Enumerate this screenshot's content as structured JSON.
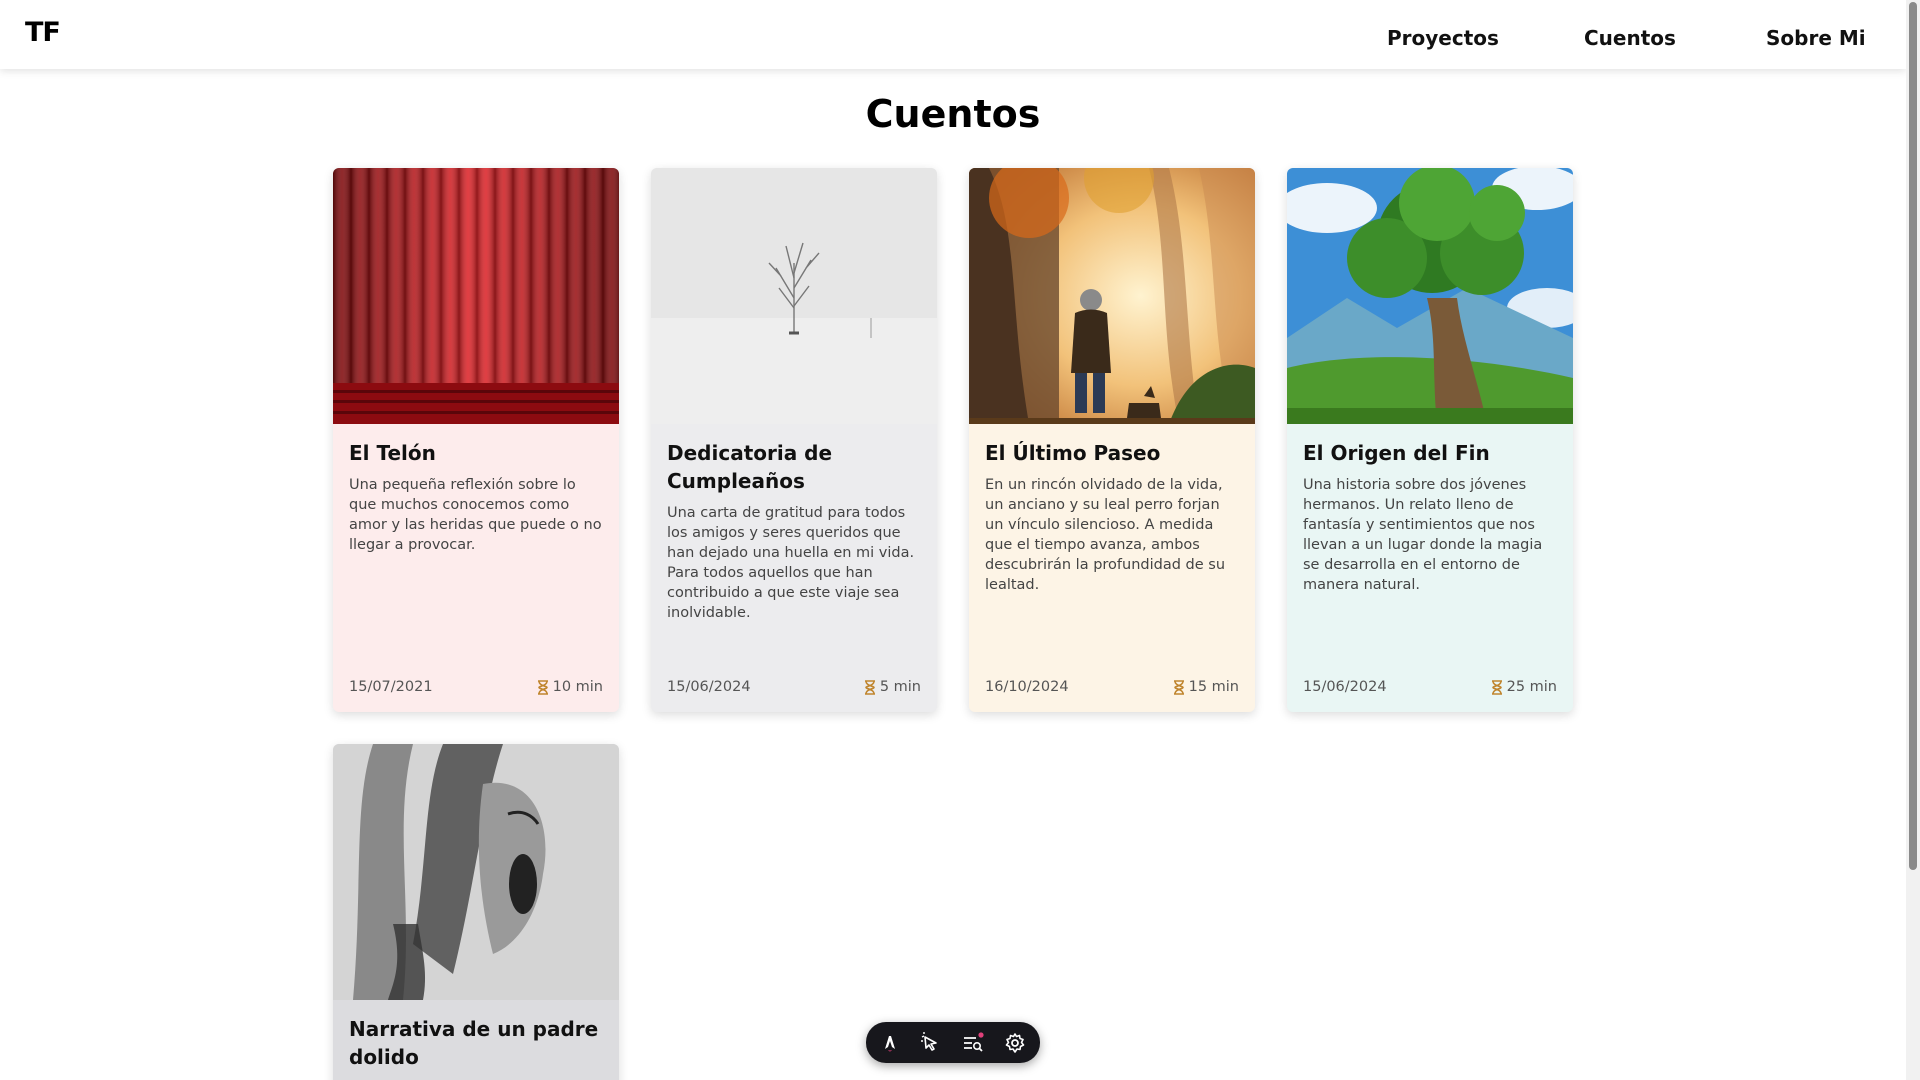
{
  "header": {
    "logo": "TF",
    "nav": [
      "Proyectos",
      "Cuentos",
      "Sobre Mi"
    ]
  },
  "page_title": "Cuentos",
  "cards": [
    {
      "title": "El Telón",
      "description": "Una pequeña reflexión sobre lo que muchos conocemos como amor y las heridas que puede o no llegar a provocar.",
      "date": "15/07/2021",
      "duration": "10 min",
      "image": "red-theater-curtain",
      "bg": "#fdecec"
    },
    {
      "title": "Dedicatoria de Cumpleaños",
      "description": "Una carta de gratitud para todos los amigos y seres queridos que han dejado una huella en mi vida. Para todos aquellos que han contribuido a que este viaje sea inolvidable.",
      "date": "15/06/2024",
      "duration": "5 min",
      "image": "lone-tree-in-snow",
      "bg": "#ececee"
    },
    {
      "title": "El Último Paseo",
      "description": "En un rincón olvidado de la vida, un anciano y su leal perro forjan un vínculo silencioso. A medida que el tiempo avanza, ambos descubrirán la profundidad de su lealtad.",
      "date": "16/10/2024",
      "duration": "15 min",
      "image": "old-man-walking-dog-in-autumn-forest",
      "bg": "#fdf4e6"
    },
    {
      "title": "El Origen del Fin",
      "description": "Una historia sobre dos jóvenes hermanos. Un relato lleno de fantasía y sentimientos que nos llevan a un lugar donde la magia se desarrolla en el entorno de manera natural.",
      "date": "15/06/2024",
      "duration": "25 min",
      "image": "giant-tree-fantasy-landscape",
      "bg": "#e9f6f4"
    },
    {
      "title": "Narrativa de un padre dolido",
      "image": "ink-painting-screaming-face",
      "bg": "#dcdcdf"
    }
  ],
  "toolbar": {
    "icons": [
      "astro-logo-icon",
      "inspect-cursor-icon",
      "audit-list-icon",
      "settings-gear-icon"
    ]
  },
  "colors": {
    "accent_progress": "#c9a15a",
    "toolbar_bg": "#17171c",
    "hourglass": "#c0852e"
  }
}
